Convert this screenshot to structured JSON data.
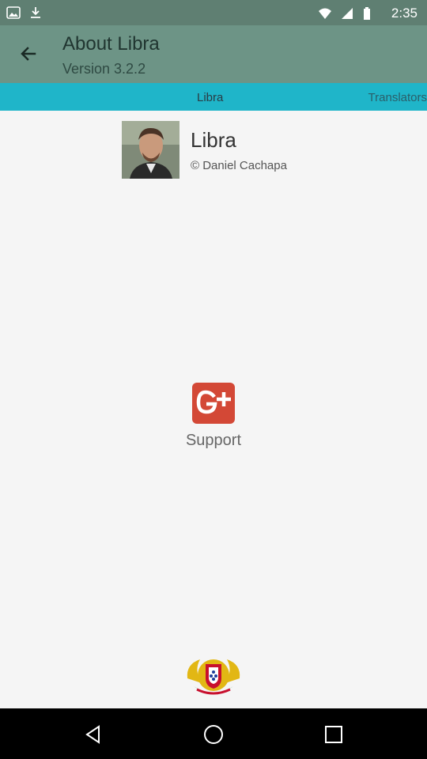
{
  "status_bar": {
    "time": "2:35"
  },
  "app_bar": {
    "title": "About Libra",
    "subtitle": "Version 3.2.2"
  },
  "tabs": [
    {
      "label": "Libra"
    },
    {
      "label": "Translators"
    }
  ],
  "app_info": {
    "name": "Libra",
    "copyright": "© Daniel Cachapa"
  },
  "support": {
    "label": "Support",
    "icon": "google-plus-icon"
  },
  "colors": {
    "status_bar": "#5f7f72",
    "app_bar": "#6d9486",
    "tabs": "#1fb5c9",
    "gplus": "#d34836",
    "background": "#f5f5f5"
  }
}
